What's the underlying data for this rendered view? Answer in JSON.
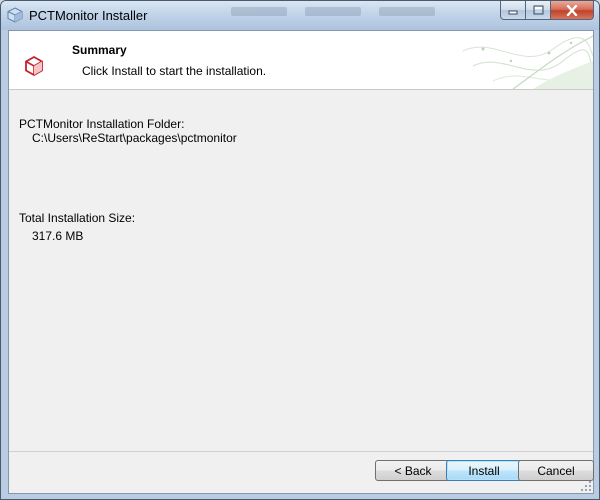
{
  "window": {
    "title": "PCTMonitor Installer",
    "icon": "installer-box-icon",
    "caption_buttons": [
      "minimize-icon",
      "maximize-icon",
      "close-icon"
    ]
  },
  "header": {
    "title": "Summary",
    "subtitle": "Click Install to start the installation.",
    "icon": "package-cube-icon"
  },
  "summary": {
    "folder_label": "PCTMonitor Installation Folder:",
    "folder_value": "C:\\Users\\ReStart\\packages\\pctmonitor",
    "size_label": "Total Installation Size:",
    "size_value": "317.6 MB"
  },
  "buttons": {
    "back": "< Back",
    "install": "Install",
    "cancel": "Cancel"
  },
  "colors": {
    "accent_red": "#c8202c",
    "default_button_border": "#3c7fb1"
  }
}
